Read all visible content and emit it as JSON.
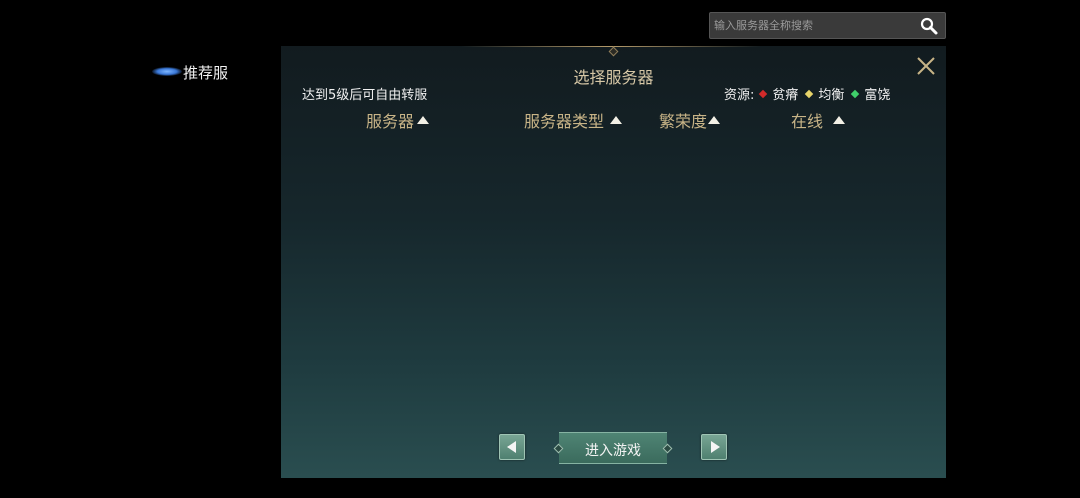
{
  "search": {
    "placeholder": "输入服务器全称搜索",
    "icon": "search-icon"
  },
  "sidebar": {
    "items": [
      {
        "label": "推荐服",
        "selected": true
      }
    ]
  },
  "panel": {
    "title": "选择服务器",
    "transfer_note": "达到5级后可自由转服",
    "legend": {
      "prefix": "资源:",
      "items": [
        {
          "label": "贫瘠",
          "color": "#d22a2a"
        },
        {
          "label": "均衡",
          "color": "#e6d36a"
        },
        {
          "label": "富饶",
          "color": "#3fcf6a"
        }
      ]
    },
    "columns": [
      {
        "label": "服务器",
        "sort": "asc"
      },
      {
        "label": "服务器类型",
        "sort": "asc"
      },
      {
        "label": "繁荣度",
        "sort": "asc"
      },
      {
        "label": "在线",
        "sort": "asc"
      }
    ],
    "rows": []
  },
  "footer": {
    "enter_label": "进入游戏",
    "prev_icon": "arrow-left-icon",
    "next_icon": "arrow-right-icon"
  },
  "colors": {
    "accent_gold": "#c8b487",
    "button_green": "#4f8474"
  }
}
